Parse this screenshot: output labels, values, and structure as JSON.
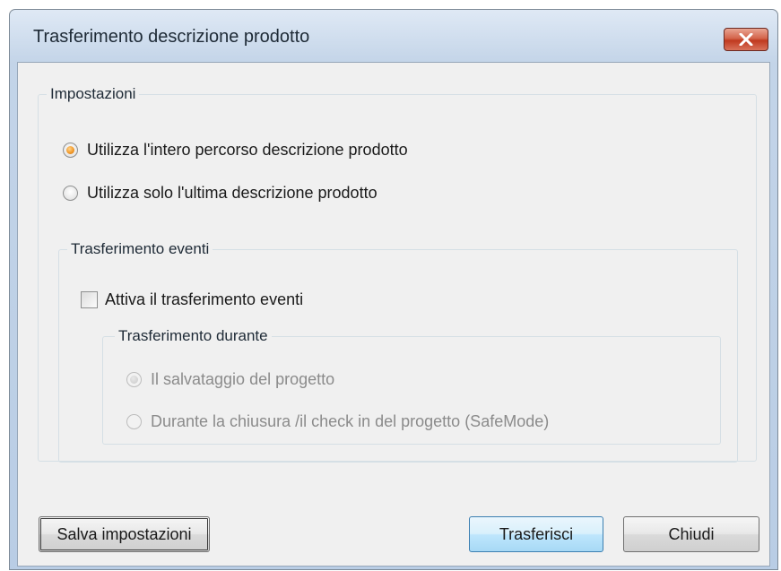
{
  "window": {
    "title": "Trasferimento descrizione prodotto",
    "close_icon": "close-x-icon"
  },
  "settings": {
    "legend": "Impostazioni",
    "options": [
      {
        "label": "Utilizza l'intero percorso descrizione prodotto",
        "checked": true
      },
      {
        "label": "Utilizza solo l'ultima descrizione prodotto",
        "checked": false
      }
    ]
  },
  "events": {
    "legend": "Trasferimento eventi",
    "enable_label": "Attiva il trasferimento eventi",
    "enabled": false,
    "during": {
      "legend": "Trasferimento durante",
      "options": [
        {
          "label": "Il salvataggio del progetto",
          "checked": true
        },
        {
          "label": "Durante la chiusura /il check in del progetto (SafeMode)",
          "checked": false
        }
      ]
    }
  },
  "buttons": {
    "save": "Salva impostazioni",
    "transfer": "Trasferisci",
    "close": "Chiudi"
  },
  "colors": {
    "accent_radio": "#f29a2a",
    "default_button": "#bee6fd",
    "close_button": "#c0391f"
  }
}
